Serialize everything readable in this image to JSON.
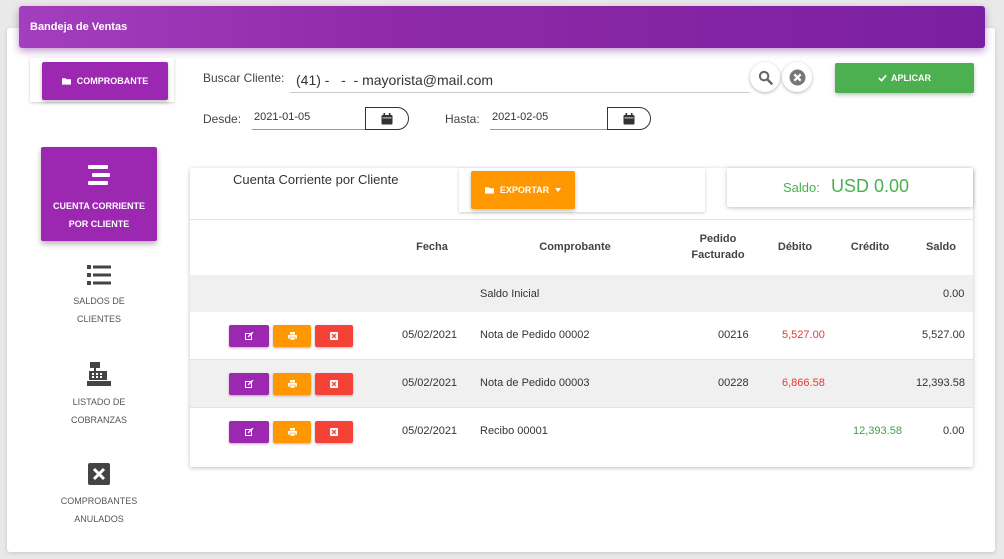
{
  "header": {
    "title": "Bandeja de Ventas"
  },
  "toolbar": {
    "comprobante_label": "COMPROBANTE",
    "search_label": "Buscar Cliente:",
    "search_value": "(41) -   -  - mayorista@mail.com",
    "aplicar_label": "APLICAR",
    "desde_label": "Desde:",
    "desde_value": "2021-01-05",
    "hasta_label": "Hasta:",
    "hasta_value": "2021-02-05"
  },
  "sidebar": {
    "items": [
      {
        "label_1": "CUENTA CORRIENTE",
        "label_2": "POR CLIENTE",
        "icon": "bars-icon"
      },
      {
        "label_1": "SALDOS DE",
        "label_2": "CLIENTES",
        "icon": "list-icon"
      },
      {
        "label_1": "LISTADO DE",
        "label_2": "COBRANZAS",
        "icon": "cash-register-icon"
      },
      {
        "label_1": "COMPROBANTES",
        "label_2": "ANULADOS",
        "icon": "x-square-icon"
      }
    ]
  },
  "main": {
    "title": "Cuenta Corriente por Cliente",
    "export_label": "EXPORTAR",
    "saldo_label": "Saldo:",
    "saldo_value": "USD 0.00",
    "columns": {
      "fecha": "Fecha",
      "comprobante": "Comprobante",
      "pedido_1": "Pedido",
      "pedido_2": "Facturado",
      "debito": "Débito",
      "credito": "Crédito",
      "saldo": "Saldo"
    },
    "saldo_inicial": {
      "label": "Saldo Inicial",
      "saldo": "0.00"
    },
    "rows": [
      {
        "fecha": "05/02/2021",
        "comprobante": "Nota de Pedido 00002",
        "pedido": "00216",
        "debito": "5,527.00",
        "credito": "",
        "saldo": "5,527.00"
      },
      {
        "fecha": "05/02/2021",
        "comprobante": "Nota de Pedido 00003",
        "pedido": "00228",
        "debito": "6,866.58",
        "credito": "",
        "saldo": "12,393.58"
      },
      {
        "fecha": "05/02/2021",
        "comprobante": "Recibo 00001",
        "pedido": "",
        "debito": "",
        "credito": "12,393.58",
        "saldo": "0.00"
      }
    ]
  },
  "colors": {
    "primary": "#9c27b0",
    "success": "#4caf50",
    "warning": "#ff9800",
    "danger": "#f44336"
  }
}
